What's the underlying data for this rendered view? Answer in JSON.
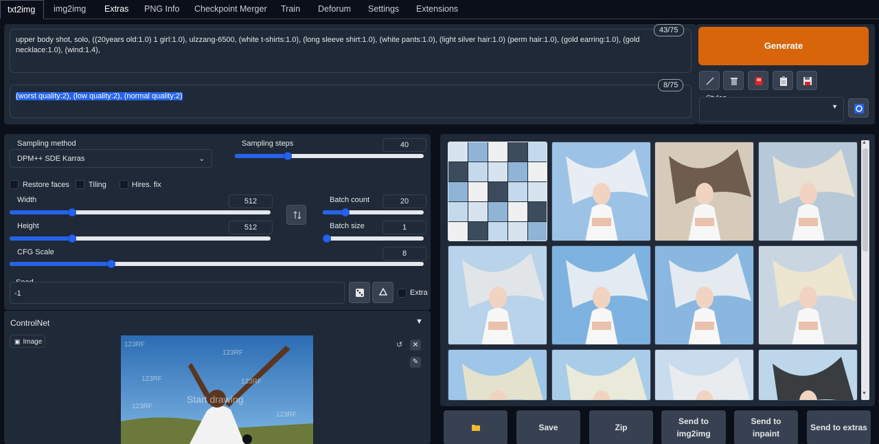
{
  "tabs": [
    "txt2img",
    "img2img",
    "Extras",
    "PNG Info",
    "Checkpoint Merger",
    "Train",
    "Deforum",
    "Settings",
    "Extensions"
  ],
  "active_tab": "txt2img",
  "prompt": {
    "text": "upper body shot, solo, ((20years old:1.0) 1 girl:1.0), ulzzang-6500, (white t-shirts:1.0), (long sleeve shirt:1.0), (white pants:1.0), (light silver hair:1.0) (perm hair:1.0), (gold earring:1.0), (gold necklace:1.0), (wind:1.4),",
    "token_count": "43/75"
  },
  "negative_prompt": {
    "text": "(worst quality:2), (low quality:2), (normal quality:2)",
    "token_count": "8/75"
  },
  "generate_label": "Generate",
  "tool_icons": [
    "pencil-icon",
    "trash-icon",
    "red-card-icon",
    "clipboard-icon",
    "save-disk-icon"
  ],
  "styles": {
    "label": "Styles",
    "value": ""
  },
  "sampling": {
    "method_label": "Sampling method",
    "method_value": "DPM++ SDE Karras",
    "steps_label": "Sampling steps",
    "steps_value": "40",
    "steps_fraction": 0.27
  },
  "options": {
    "restore_faces": "Restore faces",
    "tiling": "Tiling",
    "hires_fix": "Hires. fix"
  },
  "width": {
    "label": "Width",
    "value": "512",
    "fraction": 0.23
  },
  "height": {
    "label": "Height",
    "value": "512",
    "fraction": 0.23
  },
  "batch_count": {
    "label": "Batch count",
    "value": "20",
    "fraction": 0.2
  },
  "batch_size": {
    "label": "Batch size",
    "value": "1",
    "fraction": 0.0
  },
  "cfg": {
    "label": "CFG Scale",
    "value": "8",
    "fraction": 0.24
  },
  "seed": {
    "label": "Seed",
    "value": "-1",
    "extra_label": "Extra"
  },
  "controlnet": {
    "title": "ControlNet",
    "image_tab": "Image",
    "watermarks": [
      "123RF",
      "123RF",
      "123RF",
      "123RF",
      "123RF",
      "123RF"
    ],
    "overlay_text": "Start drawing"
  },
  "actions": {
    "folder_icon": "folder-icon",
    "save": "Save",
    "zip": "Zip",
    "send_img2img_1": "Send to",
    "send_img2img_2": "img2img",
    "send_inpaint_1": "Send to",
    "send_inpaint_2": "inpaint",
    "send_extras": "Send to extras"
  },
  "colors": {
    "accent": "#d9650b",
    "primary": "#2563eb",
    "background": "#0b0f19",
    "panel": "#1f2937"
  }
}
